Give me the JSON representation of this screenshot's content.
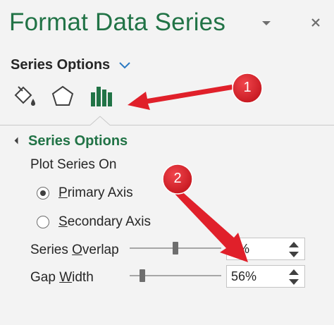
{
  "pane": {
    "title": "Format Data Series",
    "dropdown_icon": "caret-down-icon",
    "close_icon": "close-icon",
    "options_header": "Series Options",
    "tabs": [
      {
        "name": "fill-line",
        "icon": "paint-bucket-icon"
      },
      {
        "name": "effects",
        "icon": "pentagon-icon"
      },
      {
        "name": "series-options",
        "icon": "bar-chart-icon",
        "selected": true
      }
    ]
  },
  "section": {
    "title": "Series Options",
    "plot_series_on": "Plot Series On",
    "primary_axis": {
      "access_key": "P",
      "rest": "rimary Axis",
      "checked": true
    },
    "secondary_axis": {
      "access_key": "S",
      "rest": "econdary Axis",
      "checked": false
    },
    "overlap": {
      "label_pre": "Series ",
      "access_key": "O",
      "label_post": "verlap",
      "value": "0%",
      "slider_fraction": 0.5
    },
    "gap": {
      "label_pre": "Gap ",
      "access_key": "W",
      "label_post": "idth",
      "value": "56%",
      "slider_fraction": 0.112
    }
  },
  "annotations": {
    "badge1": "1",
    "badge2": "2",
    "color": "#e0202a"
  },
  "colors": {
    "accent": "#217346",
    "background": "#f3f3f3"
  }
}
